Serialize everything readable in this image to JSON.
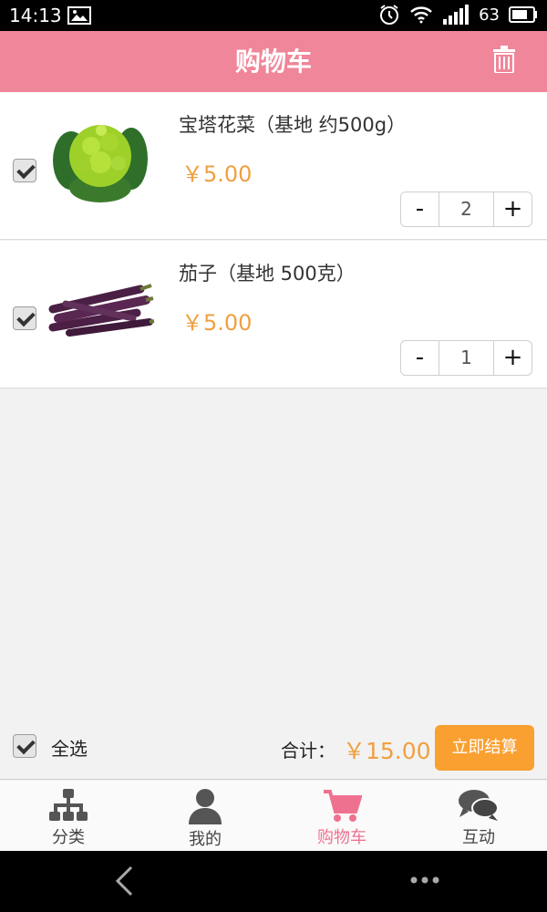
{
  "status_bar": {
    "time": "14:13",
    "battery": "63",
    "icons": [
      "image-icon",
      "alarm-icon",
      "wifi-icon",
      "signal-icon",
      "battery-icon"
    ]
  },
  "header": {
    "title": "购物车",
    "icon": "trash-icon"
  },
  "items": [
    {
      "name": "宝塔花菜（基地 约500g）",
      "price": "￥5.00",
      "quantity": "2",
      "checked": true,
      "decrement": "-",
      "increment": "+",
      "image": "romanesco-broccoli"
    },
    {
      "name": "茄子（基地 500克）",
      "price": "￥5.00",
      "quantity": "1",
      "checked": true,
      "decrement": "-",
      "increment": "+",
      "image": "purple-eggplant"
    }
  ],
  "footer": {
    "select_all": "全选",
    "select_all_checked": true,
    "total_label": "合计：",
    "total_value": "￥15.00",
    "checkout_label": "立即结算"
  },
  "tabs": [
    {
      "label": "分类",
      "icon": "category-tree-icon",
      "active": false
    },
    {
      "label": "我的",
      "icon": "user-icon",
      "active": false
    },
    {
      "label": "购物车",
      "icon": "cart-icon",
      "active": true
    },
    {
      "label": "互动",
      "icon": "chat-icon",
      "active": false
    }
  ],
  "colors": {
    "header": "#f0869a",
    "price": "#f0a040",
    "checkout": "#f9a031",
    "active_tab": "#ee7290"
  }
}
